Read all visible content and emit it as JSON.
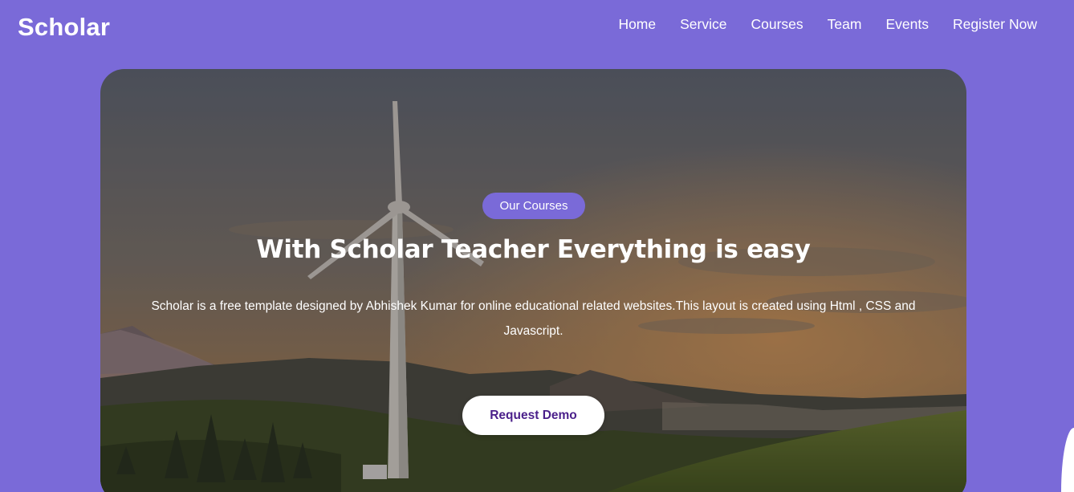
{
  "header": {
    "logo": "Scholar",
    "nav": [
      {
        "label": "Home"
      },
      {
        "label": "Service"
      },
      {
        "label": "Courses"
      },
      {
        "label": "Team"
      },
      {
        "label": "Events"
      },
      {
        "label": "Register Now"
      }
    ]
  },
  "hero": {
    "badge": "Our Courses",
    "title": "With Scholar Teacher Everything is easy",
    "description": "Scholar is a free template designed by Abhishek Kumar for online educational related websites.This layout is created using Html , CSS and Javascript.",
    "cta_label": "Request Demo",
    "background_image": "wind-turbine-landscape-photo"
  },
  "colors": {
    "brand": "#7a6ad8",
    "cta_text": "#4a1f8a",
    "white": "#ffffff"
  }
}
